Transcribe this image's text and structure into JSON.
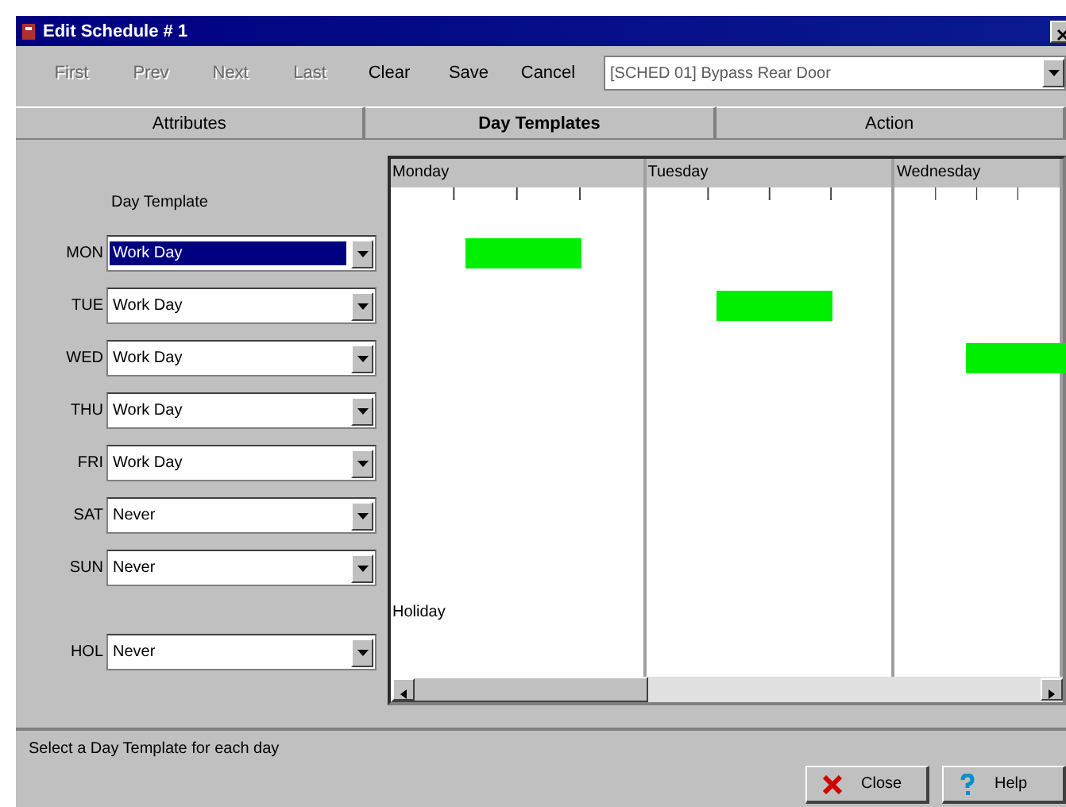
{
  "window": {
    "title": "Edit Schedule # 1"
  },
  "toolbar": {
    "buttons": [
      {
        "label": "First",
        "disabled": true
      },
      {
        "label": "Prev",
        "disabled": true
      },
      {
        "label": "Next",
        "disabled": true
      },
      {
        "label": "Last",
        "disabled": true
      },
      {
        "label": "Clear",
        "disabled": false
      },
      {
        "label": "Save",
        "disabled": false
      },
      {
        "label": "Cancel",
        "disabled": false
      }
    ],
    "record": {
      "value": "[SCHED 01] Bypass Rear Door"
    }
  },
  "tabs": [
    {
      "label": "Attributes",
      "selected": false
    },
    {
      "label": "Day Templates",
      "selected": true
    },
    {
      "label": "Action",
      "selected": false
    }
  ],
  "day_template": {
    "heading": "Day Template",
    "rows": [
      {
        "day": "MON",
        "value": "Work Day",
        "selected": true
      },
      {
        "day": "TUE",
        "value": "Work Day",
        "selected": false
      },
      {
        "day": "WED",
        "value": "Work Day",
        "selected": false
      },
      {
        "day": "THU",
        "value": "Work Day",
        "selected": false
      },
      {
        "day": "FRI",
        "value": "Work Day",
        "selected": false
      },
      {
        "day": "SAT",
        "value": "Never",
        "selected": false
      },
      {
        "day": "SUN",
        "value": "Never",
        "selected": false
      },
      {
        "day": "HOL",
        "value": "Never",
        "selected": false
      }
    ]
  },
  "timeline": {
    "days": [
      "Monday",
      "Tuesday",
      "Wednesday"
    ],
    "holiday_label": "Holiday"
  },
  "status_bar": "Select a Day Template for each day",
  "buttons": [
    {
      "kind": "close",
      "label": "Close"
    },
    {
      "kind": "help",
      "label": "Help"
    }
  ]
}
